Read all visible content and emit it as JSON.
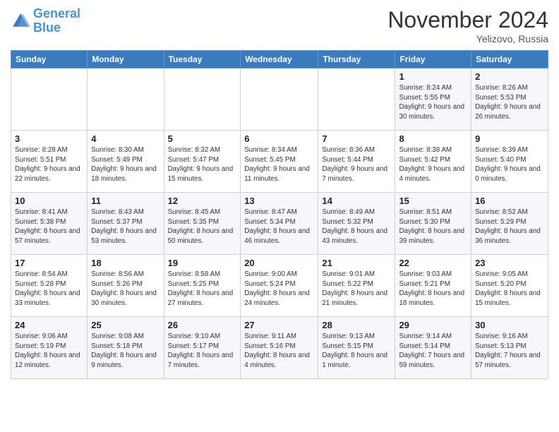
{
  "header": {
    "logo_line1": "General",
    "logo_line2": "Blue",
    "month": "November 2024",
    "location": "Yelizovo, Russia"
  },
  "weekdays": [
    "Sunday",
    "Monday",
    "Tuesday",
    "Wednesday",
    "Thursday",
    "Friday",
    "Saturday"
  ],
  "weeks": [
    [
      {
        "day": "",
        "info": ""
      },
      {
        "day": "",
        "info": ""
      },
      {
        "day": "",
        "info": ""
      },
      {
        "day": "",
        "info": ""
      },
      {
        "day": "",
        "info": ""
      },
      {
        "day": "1",
        "info": "Sunrise: 8:24 AM\nSunset: 5:55 PM\nDaylight: 9 hours and 30 minutes."
      },
      {
        "day": "2",
        "info": "Sunrise: 8:26 AM\nSunset: 5:53 PM\nDaylight: 9 hours and 26 minutes."
      }
    ],
    [
      {
        "day": "3",
        "info": "Sunrise: 8:28 AM\nSunset: 5:51 PM\nDaylight: 9 hours and 22 minutes."
      },
      {
        "day": "4",
        "info": "Sunrise: 8:30 AM\nSunset: 5:49 PM\nDaylight: 9 hours and 18 minutes."
      },
      {
        "day": "5",
        "info": "Sunrise: 8:32 AM\nSunset: 5:47 PM\nDaylight: 9 hours and 15 minutes."
      },
      {
        "day": "6",
        "info": "Sunrise: 8:34 AM\nSunset: 5:45 PM\nDaylight: 9 hours and 11 minutes."
      },
      {
        "day": "7",
        "info": "Sunrise: 8:36 AM\nSunset: 5:44 PM\nDaylight: 9 hours and 7 minutes."
      },
      {
        "day": "8",
        "info": "Sunrise: 8:38 AM\nSunset: 5:42 PM\nDaylight: 9 hours and 4 minutes."
      },
      {
        "day": "9",
        "info": "Sunrise: 8:39 AM\nSunset: 5:40 PM\nDaylight: 9 hours and 0 minutes."
      }
    ],
    [
      {
        "day": "10",
        "info": "Sunrise: 8:41 AM\nSunset: 5:38 PM\nDaylight: 8 hours and 57 minutes."
      },
      {
        "day": "11",
        "info": "Sunrise: 8:43 AM\nSunset: 5:37 PM\nDaylight: 8 hours and 53 minutes."
      },
      {
        "day": "12",
        "info": "Sunrise: 8:45 AM\nSunset: 5:35 PM\nDaylight: 8 hours and 50 minutes."
      },
      {
        "day": "13",
        "info": "Sunrise: 8:47 AM\nSunset: 5:34 PM\nDaylight: 8 hours and 46 minutes."
      },
      {
        "day": "14",
        "info": "Sunrise: 8:49 AM\nSunset: 5:32 PM\nDaylight: 8 hours and 43 minutes."
      },
      {
        "day": "15",
        "info": "Sunrise: 8:51 AM\nSunset: 5:30 PM\nDaylight: 8 hours and 39 minutes."
      },
      {
        "day": "16",
        "info": "Sunrise: 8:52 AM\nSunset: 5:29 PM\nDaylight: 8 hours and 36 minutes."
      }
    ],
    [
      {
        "day": "17",
        "info": "Sunrise: 8:54 AM\nSunset: 5:28 PM\nDaylight: 8 hours and 33 minutes."
      },
      {
        "day": "18",
        "info": "Sunrise: 8:56 AM\nSunset: 5:26 PM\nDaylight: 8 hours and 30 minutes."
      },
      {
        "day": "19",
        "info": "Sunrise: 8:58 AM\nSunset: 5:25 PM\nDaylight: 8 hours and 27 minutes."
      },
      {
        "day": "20",
        "info": "Sunrise: 9:00 AM\nSunset: 5:24 PM\nDaylight: 8 hours and 24 minutes."
      },
      {
        "day": "21",
        "info": "Sunrise: 9:01 AM\nSunset: 5:22 PM\nDaylight: 8 hours and 21 minutes."
      },
      {
        "day": "22",
        "info": "Sunrise: 9:03 AM\nSunset: 5:21 PM\nDaylight: 8 hours and 18 minutes."
      },
      {
        "day": "23",
        "info": "Sunrise: 9:05 AM\nSunset: 5:20 PM\nDaylight: 8 hours and 15 minutes."
      }
    ],
    [
      {
        "day": "24",
        "info": "Sunrise: 9:06 AM\nSunset: 5:19 PM\nDaylight: 8 hours and 12 minutes."
      },
      {
        "day": "25",
        "info": "Sunrise: 9:08 AM\nSunset: 5:18 PM\nDaylight: 8 hours and 9 minutes."
      },
      {
        "day": "26",
        "info": "Sunrise: 9:10 AM\nSunset: 5:17 PM\nDaylight: 8 hours and 7 minutes."
      },
      {
        "day": "27",
        "info": "Sunrise: 9:11 AM\nSunset: 5:16 PM\nDaylight: 8 hours and 4 minutes."
      },
      {
        "day": "28",
        "info": "Sunrise: 9:13 AM\nSunset: 5:15 PM\nDaylight: 8 hours and 1 minute."
      },
      {
        "day": "29",
        "info": "Sunrise: 9:14 AM\nSunset: 5:14 PM\nDaylight: 7 hours and 59 minutes."
      },
      {
        "day": "30",
        "info": "Sunrise: 9:16 AM\nSunset: 5:13 PM\nDaylight: 7 hours and 57 minutes."
      }
    ]
  ]
}
